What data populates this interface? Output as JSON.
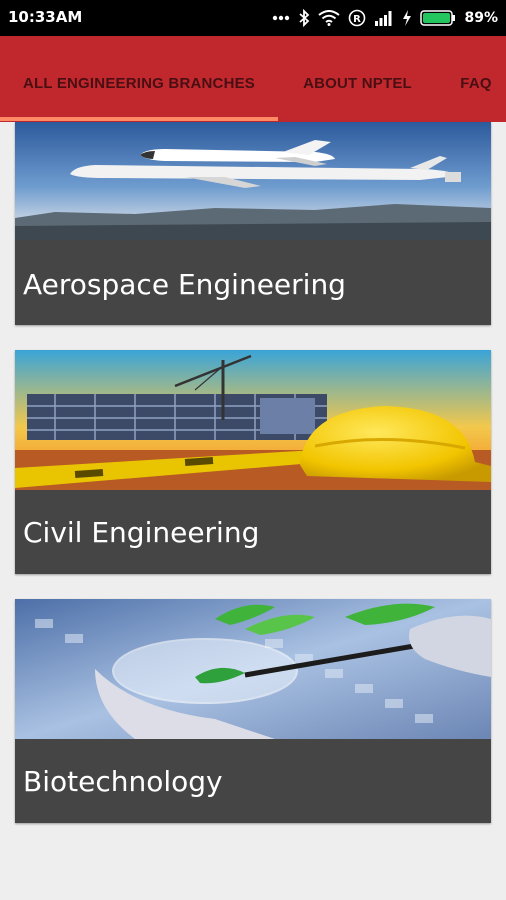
{
  "status_bar": {
    "time": "10:33AM",
    "battery_percent": "89%",
    "icons": [
      "more-dots-icon",
      "bluetooth-icon",
      "wifi-icon",
      "registered-icon",
      "signal-icon",
      "charging-bolt-icon",
      "battery-icon"
    ]
  },
  "tabs": [
    {
      "label": "ALL ENGINEERING BRANCHES",
      "active": true
    },
    {
      "label": "ABOUT NPTEL",
      "active": false
    },
    {
      "label": "FAQ",
      "active": false
    }
  ],
  "branches": [
    {
      "title": "Aerospace Engineering"
    },
    {
      "title": "Civil Engineering"
    },
    {
      "title": "Biotechnology"
    }
  ],
  "colors": {
    "app_bar": "#c0282e",
    "tab_indicator": "#ff8a65",
    "card_caption_bg": "#454545",
    "page_bg": "#eeeeee"
  }
}
